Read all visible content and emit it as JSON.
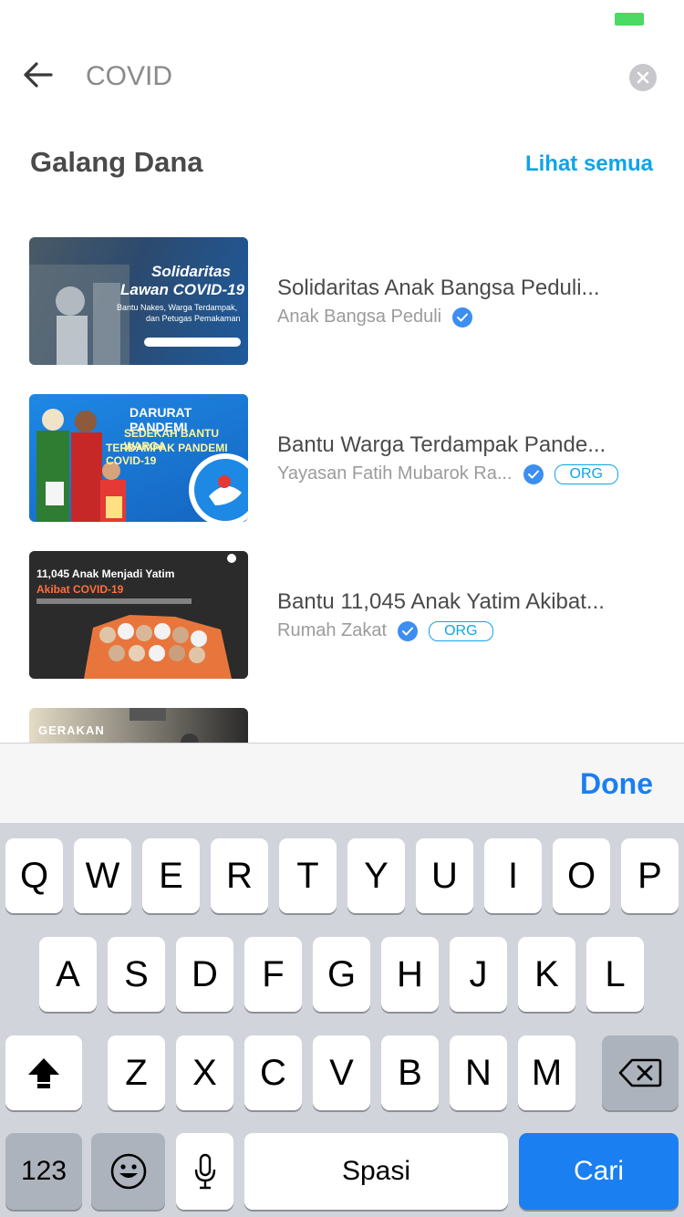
{
  "search": {
    "query": "COVID"
  },
  "section": {
    "title": "Galang Dana",
    "see_all": "Lihat semua"
  },
  "campaigns": [
    {
      "title": "Solidaritas Anak Bangsa Peduli...",
      "org": "Anak Bangsa Peduli",
      "verified": true,
      "badge": "",
      "thumb_lines": [
        "Solidaritas",
        "Lawan COVID-19",
        "Bantu Nakes, Warga Terdampak,",
        "dan Petugas Pemakaman"
      ]
    },
    {
      "title": "Bantu Warga Terdampak Pande...",
      "org": "Yayasan Fatih Mubarok Ra...",
      "verified": true,
      "badge": "ORG",
      "thumb_lines": [
        "DARURAT PANDEMI",
        "SEDEKAH BANTU WARGA",
        "TERDAMPAK PANDEMI COVID-19"
      ]
    },
    {
      "title": "Bantu 11,045 Anak Yatim Akibat...",
      "org": "Rumah Zakat",
      "verified": true,
      "badge": "ORG",
      "thumb_lines": [
        "11,045 Anak Menjadi Yatim",
        "Akibat COVID-19"
      ]
    },
    {
      "title": "",
      "org": "",
      "verified": false,
      "badge": "",
      "thumb_lines": [
        "GERAKAN"
      ]
    }
  ],
  "keyboard": {
    "done": "Done",
    "row1": [
      "Q",
      "W",
      "E",
      "R",
      "T",
      "Y",
      "U",
      "I",
      "O",
      "P"
    ],
    "row2": [
      "A",
      "S",
      "D",
      "F",
      "G",
      "H",
      "J",
      "K",
      "L"
    ],
    "row3": [
      "Z",
      "X",
      "C",
      "V",
      "B",
      "N",
      "M"
    ],
    "numbers_key": "123",
    "space_key": "Spasi",
    "return_key": "Cari"
  },
  "colors": {
    "accent": "#10a4e6",
    "keyboard_blue": "#1a7ff0",
    "verified": "#3c8ef0"
  }
}
